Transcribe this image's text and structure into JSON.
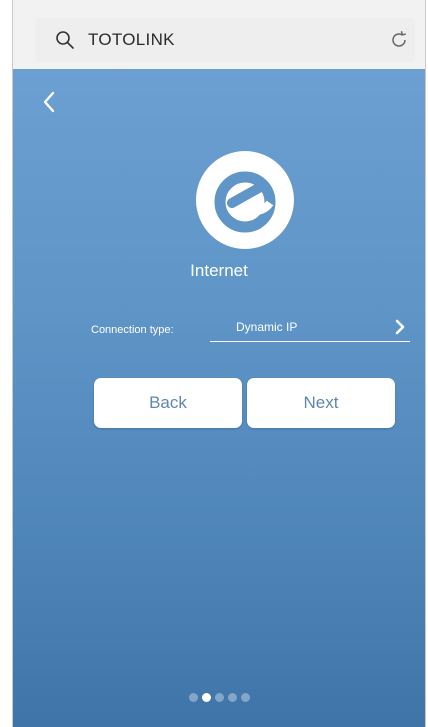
{
  "browser": {
    "url": "TOTOLINK",
    "icons": {
      "search": "search-icon",
      "reload": "reload-icon"
    }
  },
  "app": {
    "back_icon": "chevron-left-icon",
    "logo_icon": "internet-e-icon",
    "title": "Internet",
    "connection": {
      "label": "Connection type:",
      "value": "Dynamic IP",
      "icon": "chevron-right-icon"
    },
    "buttons": {
      "back": "Back",
      "next": "Next"
    },
    "pager": {
      "total": 5,
      "active_index": 1
    },
    "colors": {
      "background_top": "#6c9fd2",
      "background_bottom": "#3f74a8",
      "button_text": "#5f87b1",
      "text": "#ffffff"
    }
  }
}
